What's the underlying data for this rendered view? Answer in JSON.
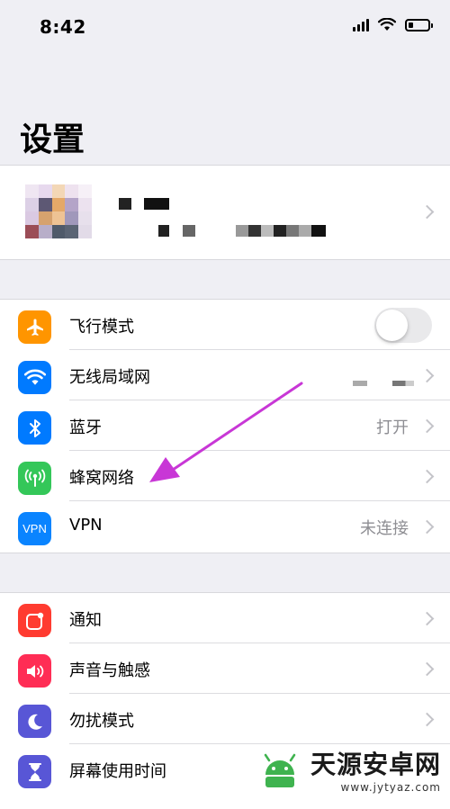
{
  "status": {
    "time": "8:42"
  },
  "page": {
    "title": "设置"
  },
  "settings": {
    "airplane": {
      "label": "飞行模式",
      "toggle_on": false
    },
    "wifi": {
      "label": "无线局域网"
    },
    "bluetooth": {
      "label": "蓝牙",
      "value": "打开"
    },
    "cellular": {
      "label": "蜂窝网络"
    },
    "vpn": {
      "label": "VPN",
      "icon_text": "VPN",
      "value": "未连接"
    },
    "notifications": {
      "label": "通知"
    },
    "sounds": {
      "label": "声音与触感"
    },
    "dnd": {
      "label": "勿扰模式"
    },
    "screentime": {
      "label": "屏幕使用时间"
    }
  },
  "colors": {
    "airplane": "#ff9500",
    "wifi": "#007aff",
    "bluetooth": "#007aff",
    "cellular": "#34c759",
    "vpn": "#0a84ff",
    "notifications": "#ff3b30",
    "sounds": "#ff2d55",
    "dnd": "#5856d6",
    "screentime": "#5856d6",
    "annotation_arrow": "#c837d6"
  },
  "icons": {
    "airplane": "airplane-icon",
    "wifi": "wifi-icon",
    "bluetooth": "bluetooth-icon",
    "cellular": "antenna-icon",
    "notifications": "notification-icon",
    "sounds": "speaker-icon",
    "dnd": "moon-icon",
    "screentime": "hourglass-icon"
  },
  "watermark": {
    "title": "天源安卓网",
    "url": "www.jytyaz.com"
  }
}
